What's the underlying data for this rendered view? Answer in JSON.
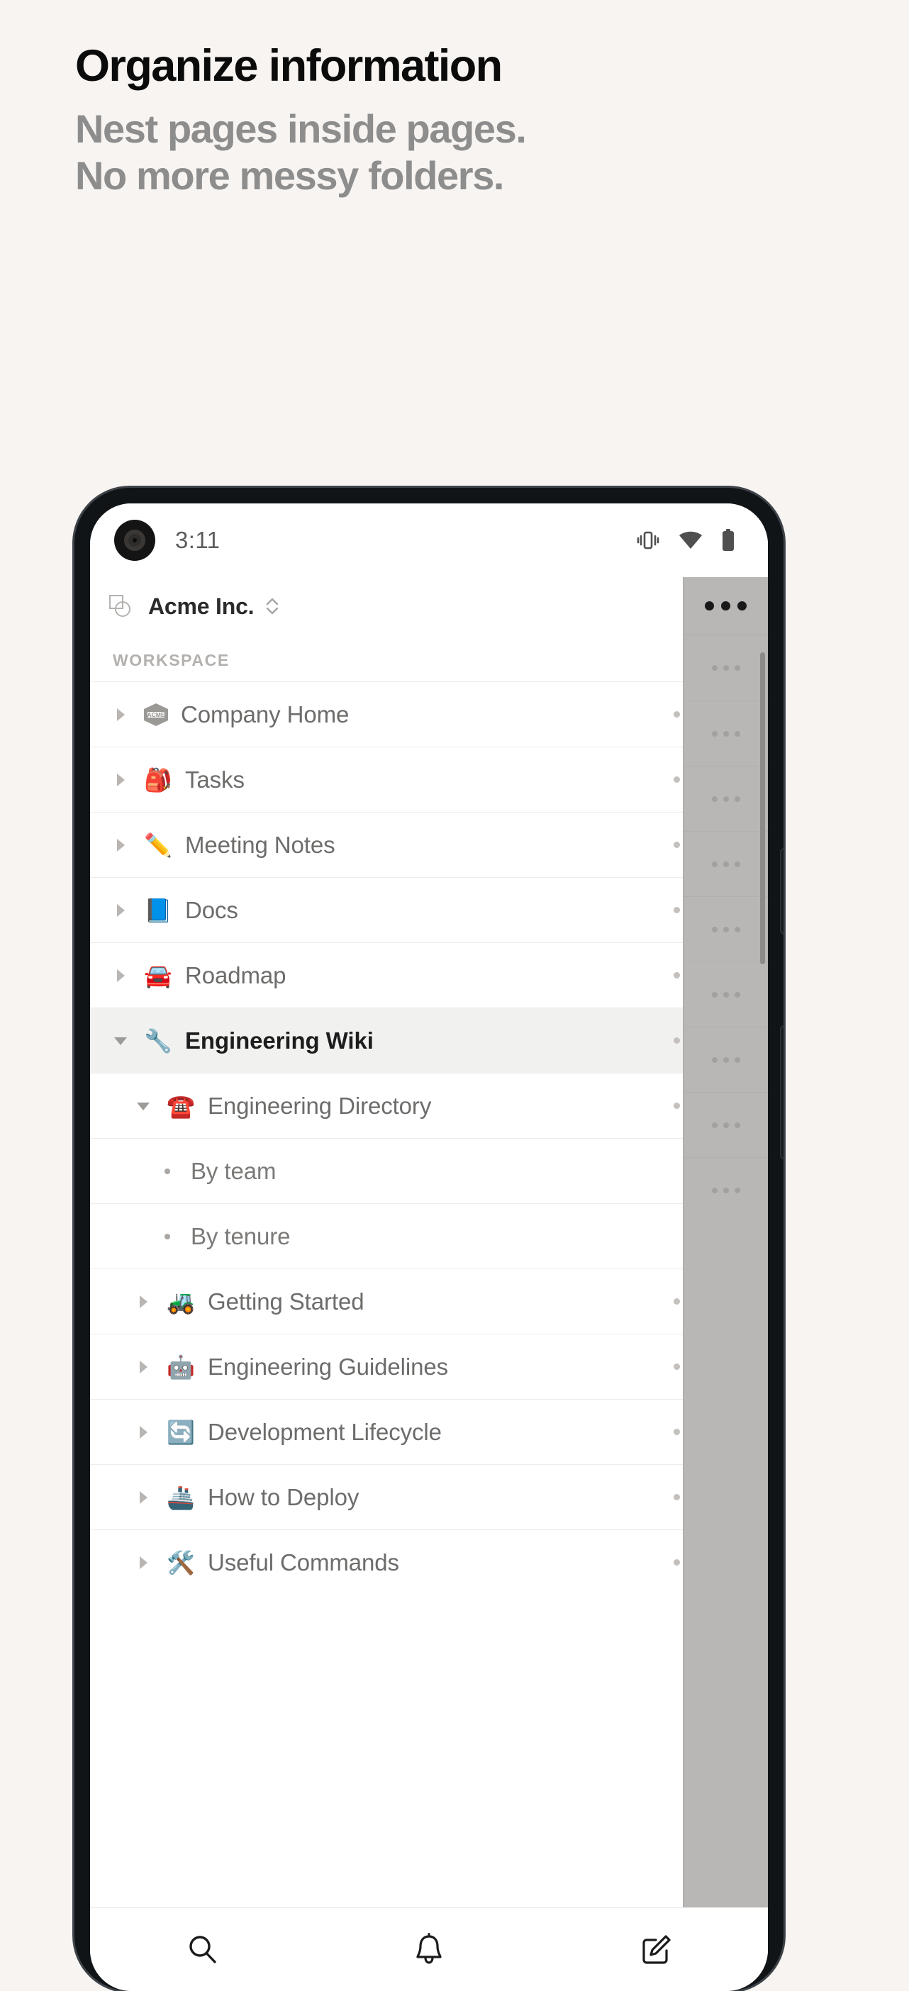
{
  "promo": {
    "title": "Organize information",
    "subtitle_line1": "Nest pages inside pages.",
    "subtitle_line2": "No more messy folders."
  },
  "status_bar": {
    "time": "3:11",
    "icons": [
      "vibrate-icon",
      "wifi-icon",
      "battery-icon"
    ]
  },
  "app_header": {
    "workspace_icon": "workspace-switcher-icon",
    "workspace_name": "Acme Inc.",
    "chevron_icon": "chevron-up-down-icon"
  },
  "sidebar": {
    "section_label": "WORKSPACE",
    "items": [
      {
        "label": "Company Home",
        "emoji": "",
        "icon_name": "acme-logo-icon",
        "level": 0,
        "twisty": "collapsed",
        "selected": false,
        "actions": true
      },
      {
        "label": "Tasks",
        "emoji": "🎒",
        "icon_name": "backpack-emoji",
        "level": 0,
        "twisty": "collapsed",
        "selected": false,
        "actions": true
      },
      {
        "label": "Meeting Notes",
        "emoji": "✏️",
        "icon_name": "pencil-emoji",
        "level": 0,
        "twisty": "collapsed",
        "selected": false,
        "actions": true
      },
      {
        "label": "Docs",
        "emoji": "📘",
        "icon_name": "blue-book-emoji",
        "level": 0,
        "twisty": "collapsed",
        "selected": false,
        "actions": true
      },
      {
        "label": "Roadmap",
        "emoji": "🚘",
        "icon_name": "car-emoji",
        "level": 0,
        "twisty": "collapsed",
        "selected": false,
        "actions": true
      },
      {
        "label": "Engineering Wiki",
        "emoji": "🔧",
        "icon_name": "wrench-emoji",
        "level": 0,
        "twisty": "expanded",
        "selected": true,
        "actions": true
      },
      {
        "label": "Engineering Directory",
        "emoji": "☎️",
        "icon_name": "telephone-emoji",
        "level": 1,
        "twisty": "expanded",
        "selected": false,
        "actions": true
      },
      {
        "label": "By team",
        "emoji": "",
        "icon_name": "bullet-dot",
        "level": 2,
        "twisty": "bullet",
        "selected": false,
        "actions": false
      },
      {
        "label": "By tenure",
        "emoji": "",
        "icon_name": "bullet-dot",
        "level": 2,
        "twisty": "bullet",
        "selected": false,
        "actions": false
      },
      {
        "label": "Getting Started",
        "emoji": "🚜",
        "icon_name": "tractor-emoji",
        "level": 1,
        "twisty": "collapsed",
        "selected": false,
        "actions": true
      },
      {
        "label": "Engineering Guidelines",
        "emoji": "🤖",
        "icon_name": "robot-emoji",
        "level": 1,
        "twisty": "collapsed",
        "selected": false,
        "actions": true
      },
      {
        "label": "Development Lifecycle",
        "emoji": "🔄",
        "icon_name": "arrows-cycle-emoji",
        "level": 1,
        "twisty": "collapsed",
        "selected": false,
        "actions": true
      },
      {
        "label": "How to Deploy",
        "emoji": "🚢",
        "icon_name": "ship-emoji",
        "level": 1,
        "twisty": "collapsed",
        "selected": false,
        "actions": true
      },
      {
        "label": "Useful Commands",
        "emoji": "🛠️",
        "icon_name": "tools-emoji",
        "level": 1,
        "twisty": "collapsed",
        "selected": false,
        "actions": true
      }
    ],
    "row_action_more": "more-options-icon",
    "row_action_add": "add-page-icon"
  },
  "drawer": {
    "more_icon": "more-options-icon",
    "row_count": 9
  },
  "bottom_nav": {
    "items": [
      {
        "icon_name": "search-icon"
      },
      {
        "icon_name": "bell-icon"
      },
      {
        "icon_name": "compose-icon"
      }
    ]
  },
  "colors": {
    "page_background": "#f8f4f1",
    "headline": "#0b0b0b",
    "subhead": "#8d8d8d",
    "phone_frame": "#111417",
    "screen": "#ffffff",
    "selected_row": "#f1f1f0",
    "drawer": "#b9b7b5"
  }
}
